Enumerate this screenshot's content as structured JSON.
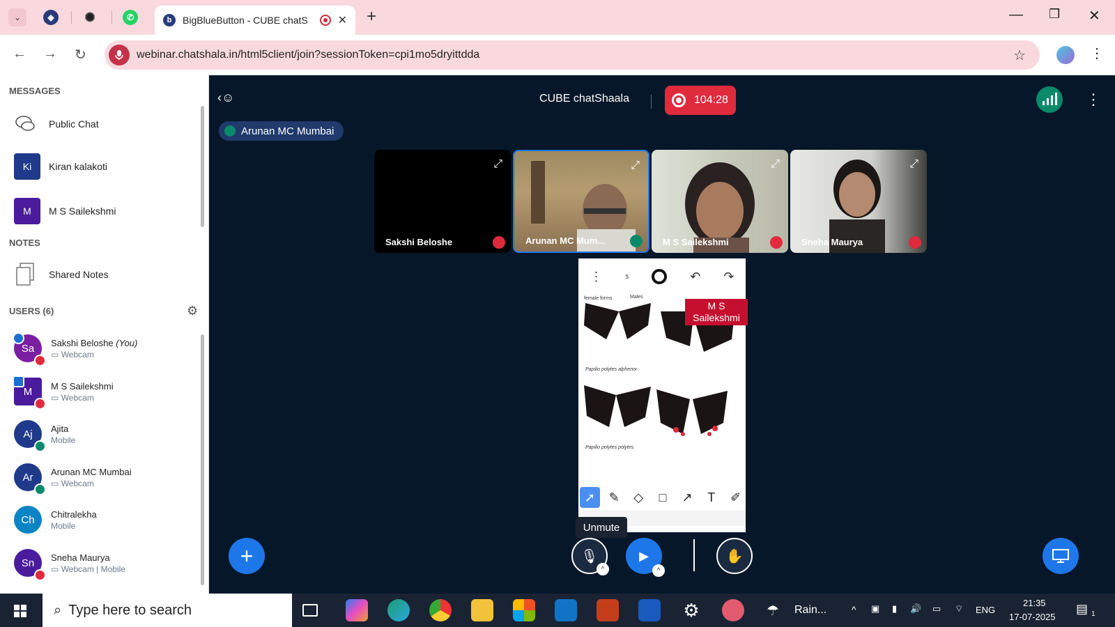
{
  "browser": {
    "active_tab_title": "BigBlueButton - CUBE chatS",
    "url": "webinar.chatshala.in/html5client/join?sessionToken=cpi1mo5dryittdda"
  },
  "sidebar": {
    "messages_heading": "MESSAGES",
    "public_chat": "Public Chat",
    "private_chats": [
      {
        "initials": "Ki",
        "name": "Kiran kalakoti",
        "color": "#1f3a8a"
      },
      {
        "initials": "M",
        "name": "M S Sailekshmi",
        "color": "#4a1b9c"
      }
    ],
    "notes_heading": "NOTES",
    "shared_notes": "Shared Notes",
    "users_heading": "USERS (6)",
    "users": [
      {
        "initials": "Sa",
        "name": "Sakshi Beloshe",
        "you": "(You)",
        "sub": "Webcam",
        "color": "#7b1fa2"
      },
      {
        "initials": "M",
        "name": "M S Sailekshmi",
        "sub": "Webcam",
        "color": "#4a1b9c"
      },
      {
        "initials": "Aj",
        "name": "Ajita",
        "sub": "Mobile",
        "color": "#1f3a8a"
      },
      {
        "initials": "Ar",
        "name": "Arunan MC Mumbai",
        "sub": "Webcam",
        "color": "#1f3a8a"
      },
      {
        "initials": "Ch",
        "name": "Chitralekha",
        "sub": "Mobile",
        "color": "#0b84c6"
      },
      {
        "initials": "Sn",
        "name": "Sneha Maurya",
        "sub": "Webcam | Mobile",
        "color": "#4a1b9c"
      }
    ]
  },
  "meeting": {
    "title": "CUBE chatShaala",
    "recording_time": "104:28",
    "talking": "Arunan MC Mumbai",
    "videos": [
      {
        "name": "Sakshi Beloshe"
      },
      {
        "name": "Arunan MC Mum..."
      },
      {
        "name": "M S Sailekshmi"
      },
      {
        "name": "Sneha Maurya"
      }
    ],
    "cursor_label": "M S\nSailekshmi",
    "slide_caption_1": "female forms",
    "slide_caption_2": "Males",
    "slide_caption_3": "Papilio polytes alphenor",
    "slide_caption_4": "Papilio polytes polytes",
    "tooltip": "Unmute"
  },
  "taskbar": {
    "search_placeholder": "Type here to search",
    "weather": "Rain...",
    "lang": "ENG",
    "time": "21:35",
    "date": "17-07-2025",
    "notif_count": "1"
  }
}
